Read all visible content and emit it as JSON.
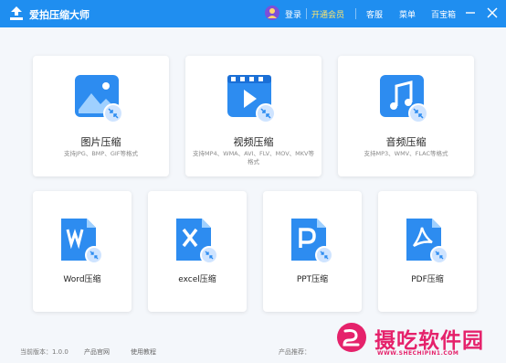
{
  "app": {
    "title": "爱拍压缩大师"
  },
  "header": {
    "login": "登录",
    "vip": "开通会员",
    "service": "客服",
    "menu": "菜单",
    "toolbox": "百宝箱"
  },
  "cards_top": [
    {
      "title": "图片压缩",
      "desc": "支持JPG、BMP、GIF等格式"
    },
    {
      "title": "视频压缩",
      "desc": "支持MP4、WMA、AVI、FLV、MOV、MKV等格式"
    },
    {
      "title": "音频压缩",
      "desc": "支持MP3、WMV、FLAC等格式"
    }
  ],
  "cards_bottom": [
    {
      "title": "Word压缩"
    },
    {
      "title": "excel压缩"
    },
    {
      "title": "PPT压缩"
    },
    {
      "title": "PDF压缩"
    }
  ],
  "footer": {
    "version": "当前版本：1.0.0",
    "official_site": "产品官网",
    "tutorial": "使用教程",
    "recommend": "产品推荐："
  },
  "watermark": {
    "cn": "摄吃软件园",
    "en": "WWW.SHECHIPIN1.COM"
  },
  "colors": {
    "primary": "#1f8ef0",
    "vip": "#ffe56a",
    "watermark": "#e5226b"
  }
}
